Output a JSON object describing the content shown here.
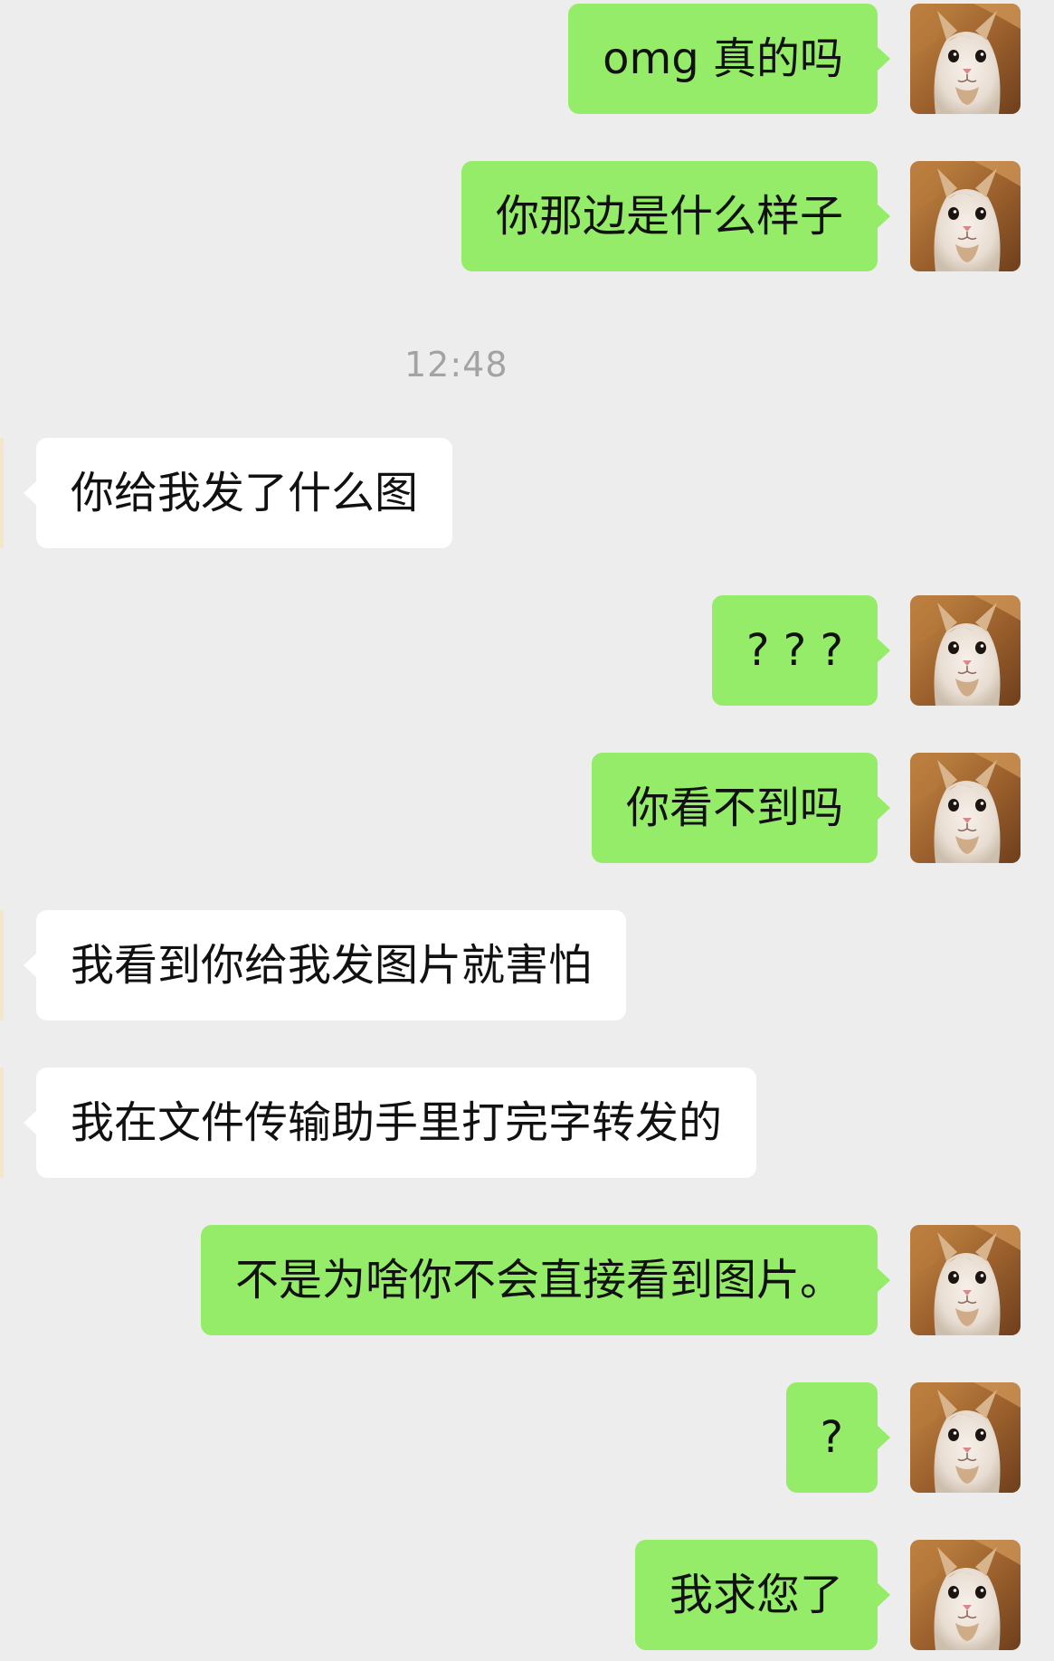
{
  "chat": {
    "timestamp": "12:48",
    "messages": [
      {
        "direction": "sent",
        "text": "omg 真的吗",
        "avatar": "cat-avatar"
      },
      {
        "direction": "sent",
        "text": "你那边是什么样子",
        "avatar": "cat-avatar"
      },
      {
        "direction": "received",
        "text": "你给我发了什么图"
      },
      {
        "direction": "sent",
        "text": "? ? ?",
        "avatar": "cat-avatar"
      },
      {
        "direction": "sent",
        "text": "你看不到吗",
        "avatar": "cat-avatar"
      },
      {
        "direction": "received",
        "text": "我看到你给我发图片就害怕"
      },
      {
        "direction": "received",
        "text": "我在文件传输助手里打完字转发的"
      },
      {
        "direction": "sent",
        "text": "不是为啥你不会直接看到图片。",
        "avatar": "cat-avatar"
      },
      {
        "direction": "sent",
        "text": "?",
        "avatar": "cat-avatar"
      },
      {
        "direction": "sent",
        "text": "我求您了",
        "avatar": "cat-avatar"
      }
    ]
  },
  "colors": {
    "background": "#ededed",
    "sent_bubble": "#95ec69",
    "received_bubble": "#ffffff",
    "text": "#111111",
    "timestamp": "#a3a3a3"
  }
}
